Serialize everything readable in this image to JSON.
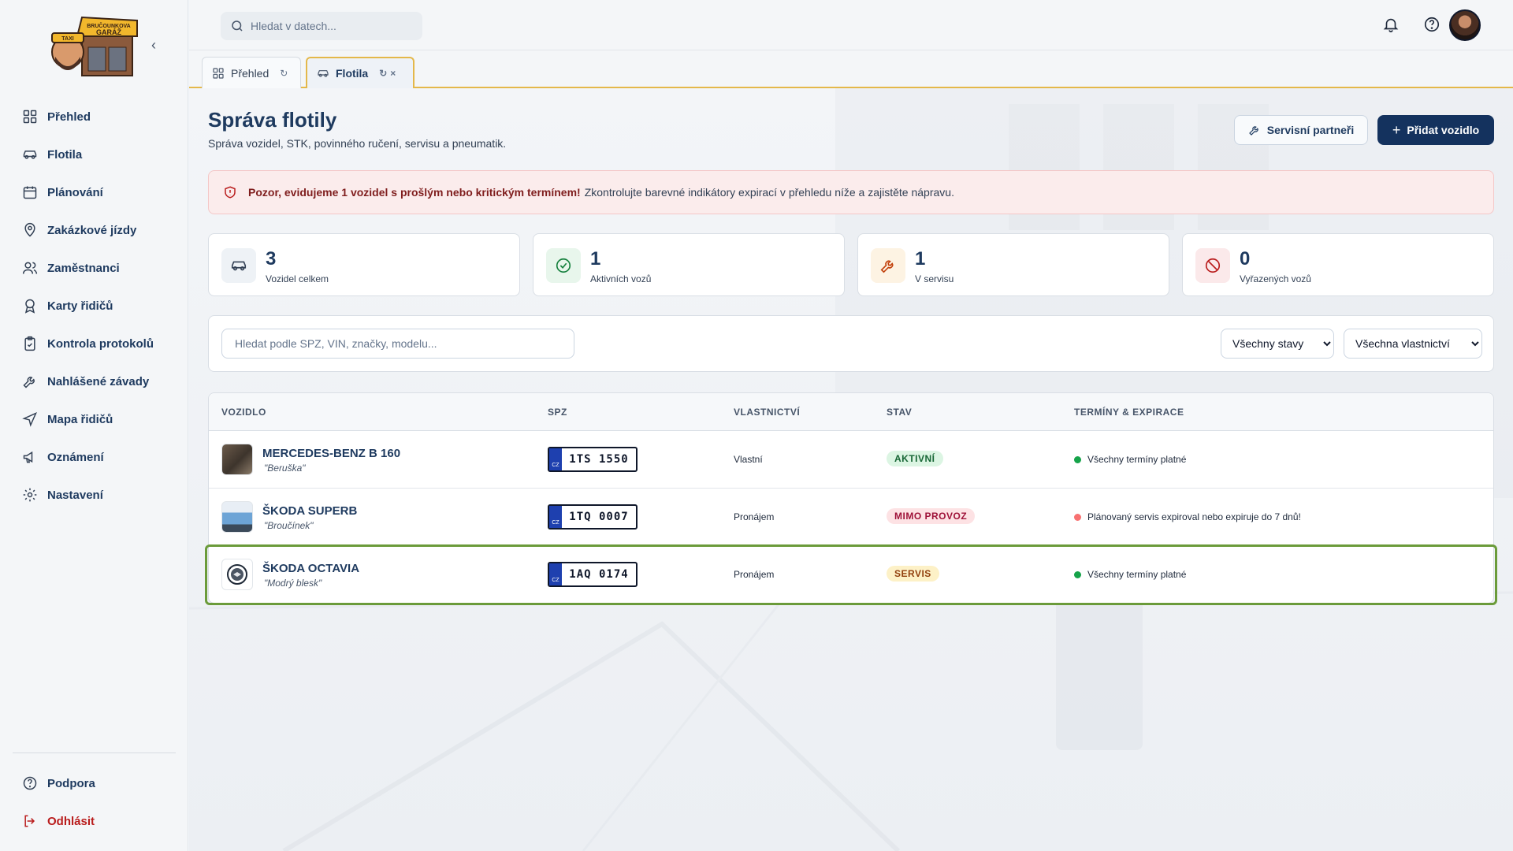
{
  "brand": {
    "line1": "BRUČOUNKOVA",
    "line2": "GARÁŽ",
    "sign": "TAXI"
  },
  "sidebar": {
    "items": [
      {
        "label": "Přehled",
        "icon": "dashboard-icon"
      },
      {
        "label": "Flotila",
        "icon": "car-icon"
      },
      {
        "label": "Plánování",
        "icon": "calendar-icon"
      },
      {
        "label": "Zakázkové jízdy",
        "icon": "map-pin-icon"
      },
      {
        "label": "Zaměstnanci",
        "icon": "users-icon"
      },
      {
        "label": "Karty řidičů",
        "icon": "badge-icon"
      },
      {
        "label": "Kontrola protokolů",
        "icon": "clipboard-check-icon"
      },
      {
        "label": "Nahlášené závady",
        "icon": "wrench-icon"
      },
      {
        "label": "Mapa řidičů",
        "icon": "navigation-icon"
      },
      {
        "label": "Oznámení",
        "icon": "megaphone-icon"
      },
      {
        "label": "Nastavení",
        "icon": "gear-icon"
      }
    ],
    "support": "Podpora",
    "logout": "Odhlásit"
  },
  "topbar": {
    "search_placeholder": "Hledat v datech..."
  },
  "tabs": [
    {
      "label": "Přehled",
      "active": false
    },
    {
      "label": "Flotila",
      "active": true
    }
  ],
  "page": {
    "title": "Správa flotily",
    "subtitle": "Správa vozidel, STK, povinného ručení, servisu a pneumatik.",
    "partners_button": "Servisní partneři",
    "add_button": "Přidat vozidlo"
  },
  "alert": {
    "bold": "Pozor, evidujeme 1 vozidel s prošlým nebo kritickým termínem!",
    "text": "Zkontrolujte barevné indikátory expirací v přehledu níže a zajistěte nápravu."
  },
  "stats": [
    {
      "value": "3",
      "label": "Vozidel celkem",
      "icon": "car-icon",
      "color": "#334155",
      "bg": "#eef2f6"
    },
    {
      "value": "1",
      "label": "Aktivních vozů",
      "icon": "check-circle-icon",
      "color": "#15803d",
      "bg": "#e8f6ec"
    },
    {
      "value": "1",
      "label": "V servisu",
      "icon": "wrench-icon",
      "color": "#c2410c",
      "bg": "#fdf3e3"
    },
    {
      "value": "0",
      "label": "Vyřazených vozů",
      "icon": "ban-icon",
      "color": "#b91c1c",
      "bg": "#fbe9ea"
    }
  ],
  "filters": {
    "search_placeholder": "Hledat podle SPZ, VIN, značky, modelu...",
    "status_selected": "Všechny stavy",
    "ownership_selected": "Všechna vlastnictví"
  },
  "table": {
    "headers": [
      "VOZIDLO",
      "SPZ",
      "VLASTNICTVÍ",
      "STAV",
      "TERMÍNY & EXPIRACE"
    ],
    "rows": [
      {
        "name": "MERCEDES-BENZ B 160",
        "nick": "\"Beruška\"",
        "plate": "1TS 1550",
        "plate_country": "CZ",
        "ownership": "Vlastní",
        "status": "AKTIVNÍ",
        "status_kind": "active",
        "term": "Všechny termíny platné",
        "term_color": "#16a34a"
      },
      {
        "name": "ŠKODA SUPERB",
        "nick": "\"Broučínek\"",
        "plate": "1TQ 0007",
        "plate_country": "CZ",
        "ownership": "Pronájem",
        "status": "MIMO PROVOZ",
        "status_kind": "off",
        "term": "Plánovaný servis expiroval nebo expiruje do 7 dnů!",
        "term_color": "#f87171"
      },
      {
        "name": "ŠKODA OCTAVIA",
        "nick": "\"Modrý blesk\"",
        "plate": "1AQ 0174",
        "plate_country": "CZ",
        "ownership": "Pronájem",
        "status": "SERVIS",
        "status_kind": "service",
        "term": "Všechny termíny platné",
        "term_color": "#16a34a"
      }
    ]
  }
}
